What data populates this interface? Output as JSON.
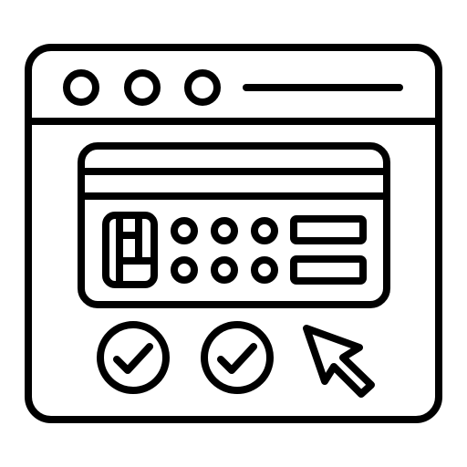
{
  "icon": {
    "name": "online-card-payment-icon",
    "style": "line-art",
    "stroke_color": "#000000",
    "background_color": "#ffffff"
  },
  "browser_window": {
    "control_dots": [
      "window-dot-icon",
      "window-dot-icon",
      "window-dot-icon"
    ],
    "address_bar": "address-bar-line-icon"
  },
  "payment_card": {
    "chip": "card-chip-icon",
    "number_dots_rows": 2,
    "number_dots_per_row": 3,
    "info_fields": 2
  },
  "confirmations": [
    "checkmark-circle-icon",
    "checkmark-circle-icon"
  ],
  "pointer": "mouse-cursor-icon"
}
